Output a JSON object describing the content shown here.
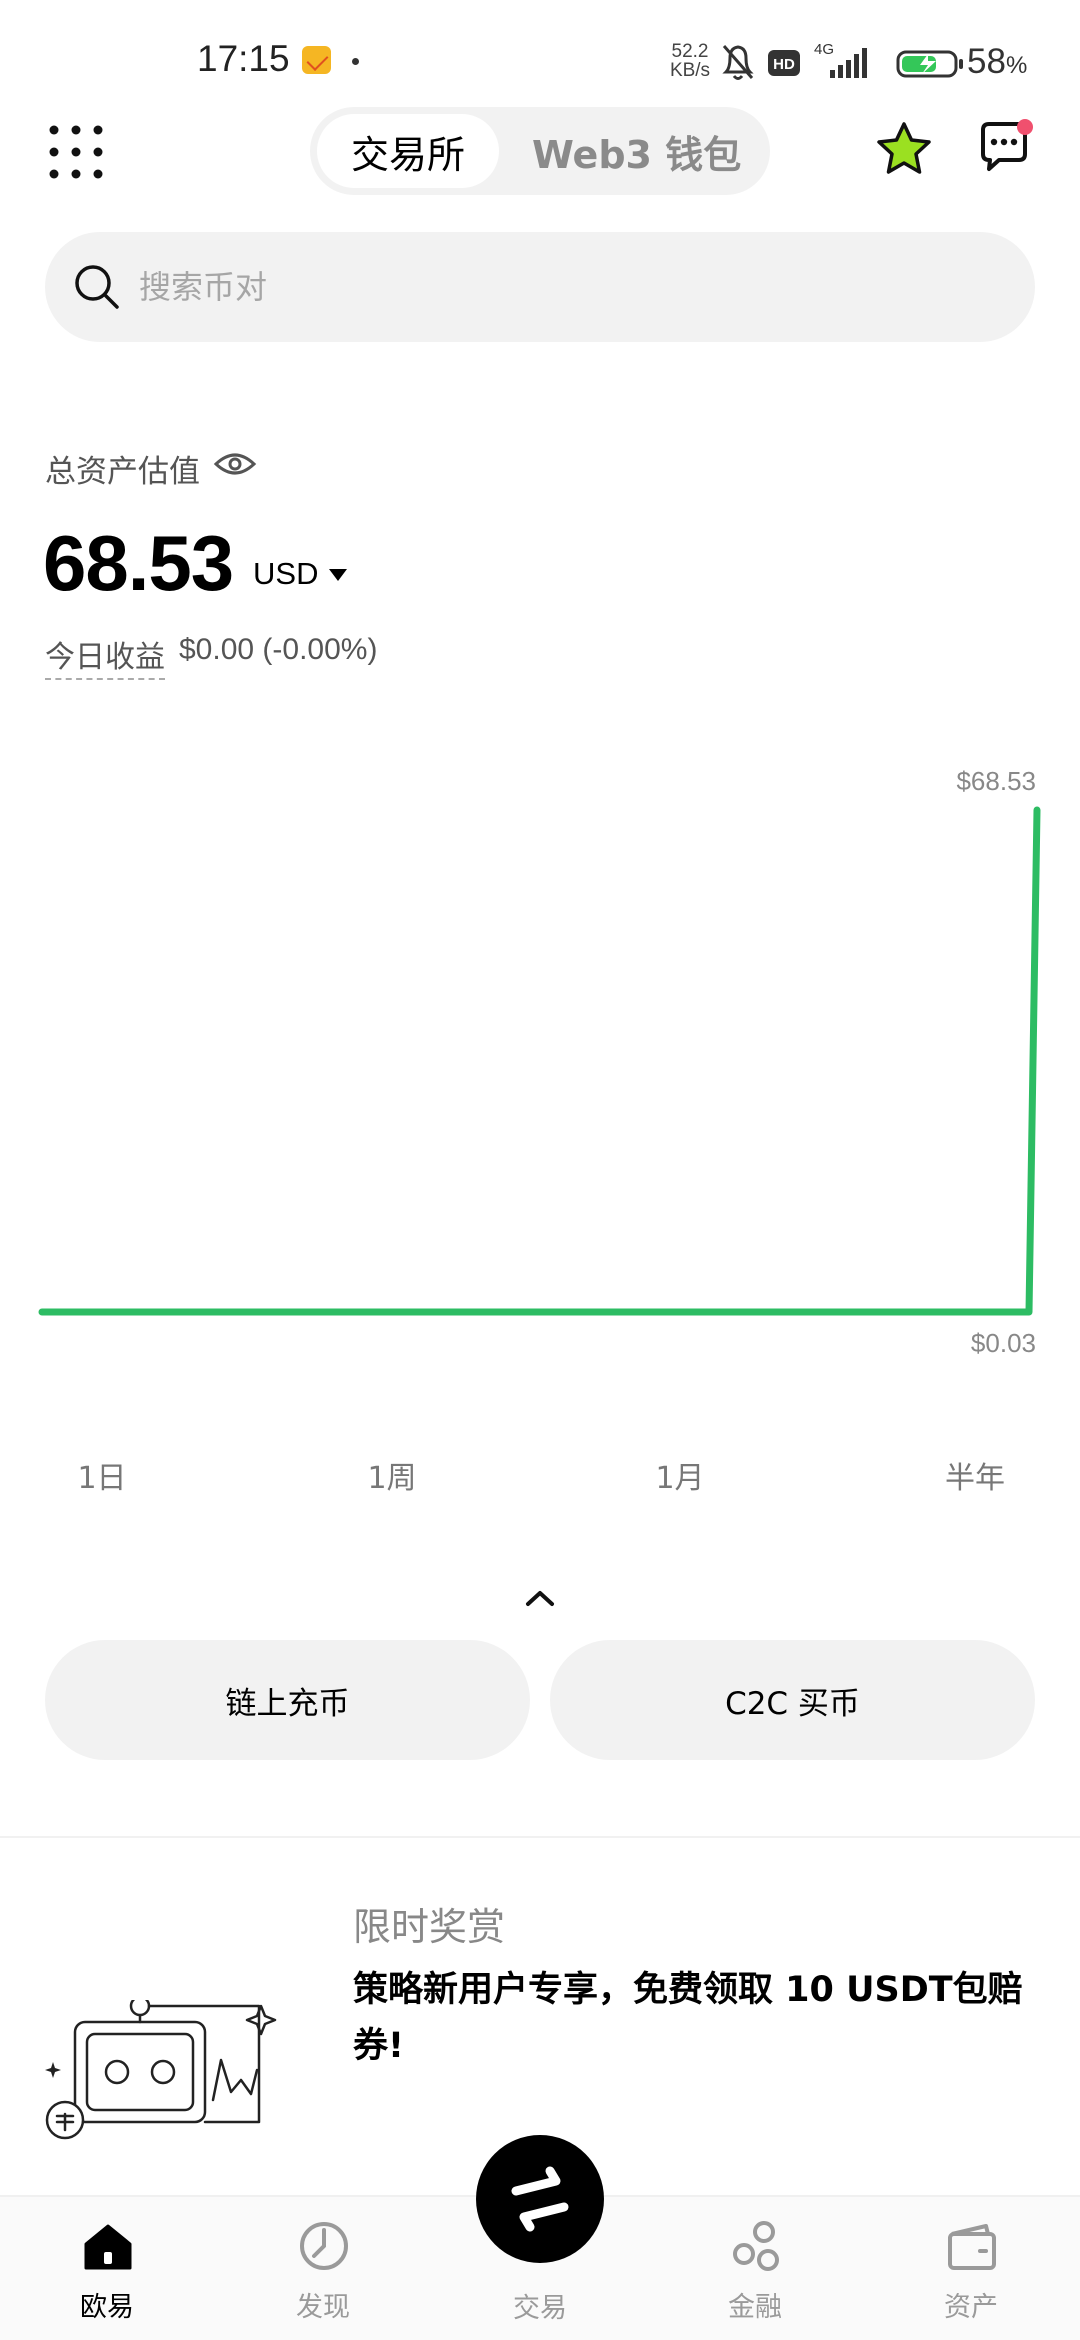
{
  "status_bar": {
    "time": "17:15",
    "net_speed_value": "52.2",
    "net_speed_unit": "KB/s",
    "network_type": "4G",
    "hd_label": "HD",
    "battery_percent": "58",
    "battery_unit": "%"
  },
  "header": {
    "tabs": [
      "交易所",
      "Web3 钱包"
    ],
    "active_tab": 0
  },
  "search": {
    "placeholder": "搜索币对"
  },
  "assets": {
    "label": "总资产估值",
    "value": "68.53",
    "currency": "USD",
    "pnl_label": "今日收益",
    "pnl_value": "$0.00 (-0.00%)"
  },
  "chart_data": {
    "type": "line",
    "max_label": "$68.53",
    "min_label": "$0.03",
    "y": [
      0.03,
      0.03,
      0.03,
      0.03,
      0.03,
      0.03,
      0.03,
      0.03,
      0.03,
      0.03,
      68.53
    ],
    "color": "#2dbc63"
  },
  "ranges": [
    "1日",
    "1周",
    "1月",
    "半年"
  ],
  "active_range": 0,
  "actions": {
    "deposit": "链上充币",
    "c2c": "C2C 买币"
  },
  "promo": {
    "title": "限时奖赏",
    "description": "策略新用户专享，免费领取 10 USDT包赔券!"
  },
  "bottom_nav": {
    "items": [
      "欧易",
      "发现",
      "交易",
      "金融",
      "资产"
    ],
    "active": 0
  },
  "colors": {
    "accent_green": "#2dbc63",
    "star_green": "#9be021",
    "notification_red": "#f0506e"
  }
}
